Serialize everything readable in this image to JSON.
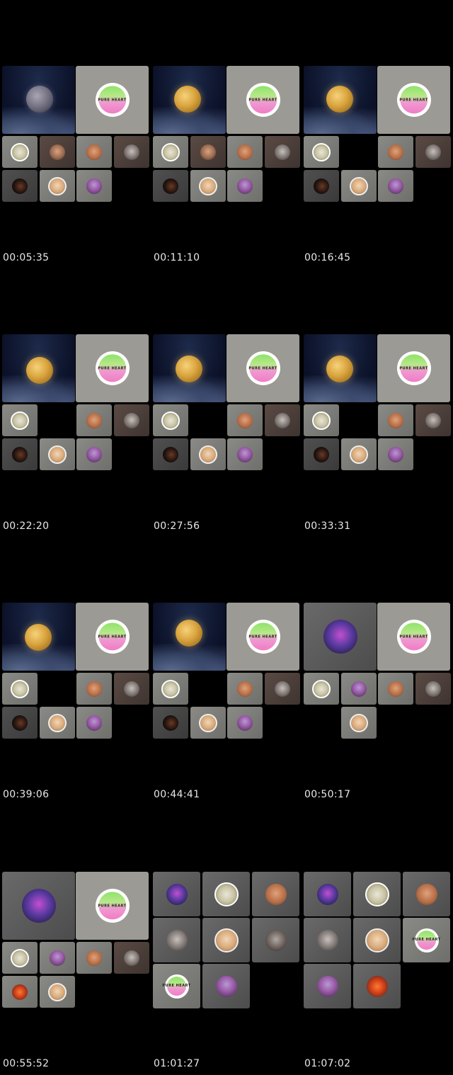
{
  "timestamps": [
    "00:05:35",
    "00:11:10",
    "00:16:45",
    "00:22:20",
    "00:27:56",
    "00:33:31",
    "00:39:06",
    "00:44:41",
    "00:50:17",
    "00:55:52",
    "01:01:27",
    "01:07:02"
  ],
  "pure_logo_text": "PURE HEART"
}
